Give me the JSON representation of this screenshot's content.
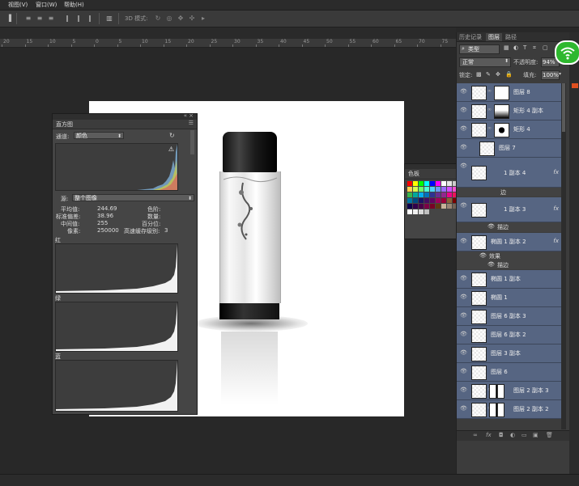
{
  "menu": {
    "view": "视图(V)",
    "window": "窗口(W)",
    "help": "帮助(H)"
  },
  "options": {
    "mode_3d": "3D 模式:"
  },
  "ruler": {
    "ticks": [
      "20",
      "15",
      "10",
      "5",
      "0",
      "5",
      "10",
      "15",
      "20",
      "25",
      "30",
      "35",
      "40",
      "45",
      "50",
      "55",
      "60",
      "65",
      "70",
      "75"
    ]
  },
  "histogram": {
    "title": "直方图",
    "channel_label": "通道:",
    "channel_value": "颜色",
    "source_label": "源:",
    "source_value": "整个图像",
    "stats": {
      "mean_label": "平均值:",
      "mean": "244.69",
      "std_label": "标准偏差:",
      "std": "38.96",
      "median_label": "中间值:",
      "median": "255",
      "pixels_label": "像素:",
      "pixels": "250000",
      "level_label": "色阶:",
      "count_label": "数量:",
      "percentile_label": "百分位:",
      "cache_label": "高速缓存级别:",
      "cache": "3"
    },
    "red_label": "红",
    "green_label": "绿",
    "blue_label": "蓝"
  },
  "swatches": {
    "title": "色板",
    "colors": [
      "#ff0000",
      "#ffff00",
      "#00ff00",
      "#00ffff",
      "#0000ff",
      "#ff00ff",
      "#ffffff",
      "#e6e6e6",
      "#cccccc",
      "#b3b3b3",
      "#999999",
      "#808080",
      "#666666",
      "#4d4d4d",
      "#ff6a6a",
      "#ff9a4f",
      "#ffd24f",
      "#d6ff4f",
      "#6aff6a",
      "#4fffd2",
      "#4fd2ff",
      "#6a9aff",
      "#9a6aff",
      "#d24fff",
      "#ff4fd2",
      "#333333",
      "#1a1a1a",
      "#000000",
      "#ef4136",
      "#f7941d",
      "#fff200",
      "#8dc63f",
      "#39b54a",
      "#00a99d",
      "#00aeef",
      "#0072bc",
      "#2e3192",
      "#662d91",
      "#92278f",
      "#ec008c",
      "#ed145b",
      "#c69c6d",
      "#9e0b0f",
      "#a0410d",
      "#aba000",
      "#598527",
      "#197b30",
      "#007236",
      "#0076a3",
      "#004a80",
      "#1b1464",
      "#440e62",
      "#630460",
      "#9e005d",
      "#9e0039",
      "#8c6239",
      "#790000",
      "#7b2e00",
      "#827b00",
      "#406618",
      "#005e20",
      "#005826",
      "#005b7f",
      "#003663",
      "#0d004c",
      "#32004b",
      "#4b0049",
      "#7b0046",
      "#7a0026",
      "#603913",
      "#c7b299",
      "#998675",
      "#736357",
      "#534741",
      "#362f2d",
      "#a67c52",
      "#754c24",
      "#5f3b16",
      "#42210b",
      "#2b1607",
      "#ffffff",
      "#f0f0f0",
      "#d9d9d9",
      "#c0c0c0"
    ]
  },
  "right_panel": {
    "tabs": [
      "历史记录",
      "图层",
      "路径"
    ],
    "filter": "类型",
    "blend_mode": "正常",
    "opacity_label": "不透明度:",
    "opacity": "94%",
    "lock_label": "锁定:",
    "fill_label": "填充:",
    "fill": "100%",
    "layers": [
      {
        "name": "图层 8",
        "mask": true,
        "fx": false
      },
      {
        "name": "矩形 4 副本",
        "mask": true,
        "fx": false
      },
      {
        "name": "矩形 4",
        "mask": true,
        "fx": false
      },
      {
        "name": "图层 7",
        "mask": false,
        "fx": false
      },
      {
        "name": "1 副本 4",
        "mask": false,
        "fx": true
      },
      {
        "name": "1 副本 3",
        "mask": false,
        "fx": true
      },
      {
        "name": "椭圆 1 副本 2",
        "mask": false,
        "fx": true
      },
      {
        "name": "椭圆 1 副本",
        "mask": false,
        "fx": false
      },
      {
        "name": "椭圆 1",
        "mask": false,
        "fx": false
      },
      {
        "name": "图层 6 副本 3",
        "mask": false,
        "fx": false
      },
      {
        "name": "图层 6 副本 2",
        "mask": false,
        "fx": false
      },
      {
        "name": "图层 3 副本",
        "mask": false,
        "fx": false
      },
      {
        "name": "图层 6",
        "mask": false,
        "fx": false
      },
      {
        "name": "图层 2 副本 3",
        "mask": true,
        "fx": false
      },
      {
        "name": "图层 2 副本 2",
        "mask": true,
        "fx": false
      }
    ],
    "effect_stroke": "描边",
    "effect_label": "效果",
    "effect_fill": "描边",
    "layer_fx": "fx",
    "edge_label": "边"
  },
  "colors": {
    "accent": "#566582",
    "panel": "#454545",
    "wifi": "#2eb82e"
  }
}
